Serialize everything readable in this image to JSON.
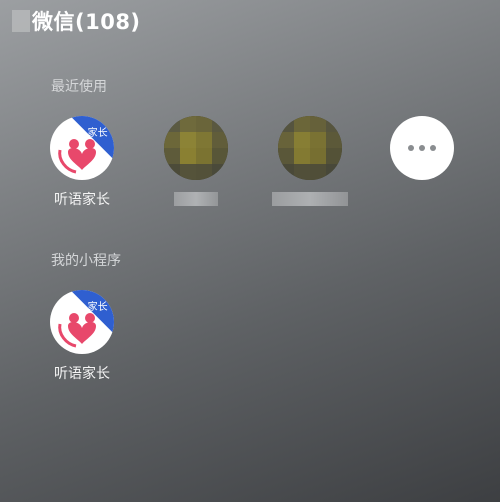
{
  "header": {
    "title": "微信(108)"
  },
  "recent": {
    "label": "最近使用",
    "items": [
      {
        "name": "听语家长",
        "badge": "家长",
        "icon": "tingyu-parent-logo"
      },
      {
        "name": "",
        "icon": "pixelated-avatar"
      },
      {
        "name": "",
        "icon": "pixelated-avatar"
      },
      {
        "name": "",
        "icon": "more-dots-icon"
      }
    ]
  },
  "mine": {
    "label": "我的小程序",
    "items": [
      {
        "name": "听语家长",
        "badge": "家长",
        "icon": "tingyu-parent-logo"
      }
    ]
  },
  "colors": {
    "logo_pink": "#e8486b",
    "badge_blue": "#2f5fd0"
  }
}
